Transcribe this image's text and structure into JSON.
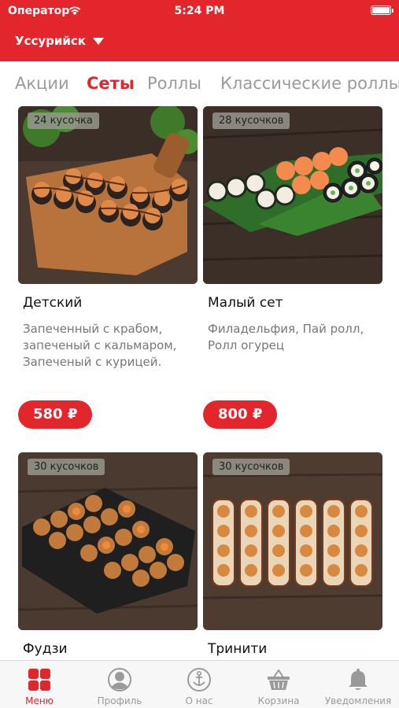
{
  "status_bar": {
    "carrier": "Оператор",
    "time": "5:24 PM"
  },
  "header": {
    "city": "Уссурийск"
  },
  "tabs": [
    {
      "label": "Акции",
      "active": false
    },
    {
      "label": "Сеты",
      "active": true
    },
    {
      "label": "Роллы",
      "active": false
    },
    {
      "label": "Классические роллы",
      "active": false
    }
  ],
  "products": [
    {
      "name": "Детский",
      "pieces": "24 кусочка",
      "description": "Запеченный с крабом, запеченый с кальмаром, Запеченый с курицей.",
      "price": "580 ₽"
    },
    {
      "name": "Малый сет",
      "pieces": "28 кусочков",
      "description": "Филадельфия, Пай ролл, Ролл огурец",
      "price": "800 ₽"
    },
    {
      "name": "Фудзи",
      "pieces": "30 кусочков",
      "description": "",
      "price": ""
    },
    {
      "name": "Тринити",
      "pieces": "30 кусочков",
      "description": "",
      "price": ""
    }
  ],
  "bottom_nav": [
    {
      "label": "Меню",
      "icon": "menu-grid-icon",
      "active": true
    },
    {
      "label": "Профиль",
      "icon": "profile-icon",
      "active": false
    },
    {
      "label": "О нас",
      "icon": "anchor-icon",
      "active": false
    },
    {
      "label": "Корзина",
      "icon": "basket-icon",
      "active": false
    },
    {
      "label": "Уведомления",
      "icon": "bell-icon",
      "active": false
    }
  ],
  "colors": {
    "accent": "#e3262c",
    "inactive": "#9a9a9a"
  }
}
